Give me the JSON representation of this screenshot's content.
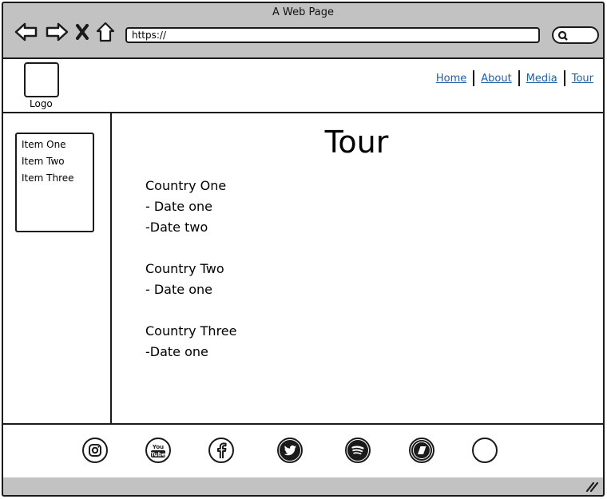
{
  "window": {
    "title": "A Web Page"
  },
  "address_bar": {
    "url": "https://"
  },
  "header": {
    "logo_label": "Logo",
    "nav": [
      {
        "label": "Home"
      },
      {
        "label": "About"
      },
      {
        "label": "Media"
      },
      {
        "label": "Tour"
      }
    ]
  },
  "sidebar": {
    "items": [
      {
        "label": "Item One"
      },
      {
        "label": "Item Two"
      },
      {
        "label": "Item Three"
      }
    ]
  },
  "main": {
    "title": "Tour",
    "countries": [
      {
        "name": "Country One",
        "dates": [
          "- Date one",
          "-Date two"
        ]
      },
      {
        "name": "Country Two",
        "dates": [
          "- Date one"
        ]
      },
      {
        "name": "Country Three",
        "dates": [
          "-Date one"
        ]
      }
    ]
  },
  "footer": {
    "social_icons": [
      "instagram-icon",
      "youtube-icon",
      "facebook-icon",
      "twitter-icon",
      "spotify-icon",
      "bandcamp-icon",
      "blank-circle-icon"
    ]
  }
}
